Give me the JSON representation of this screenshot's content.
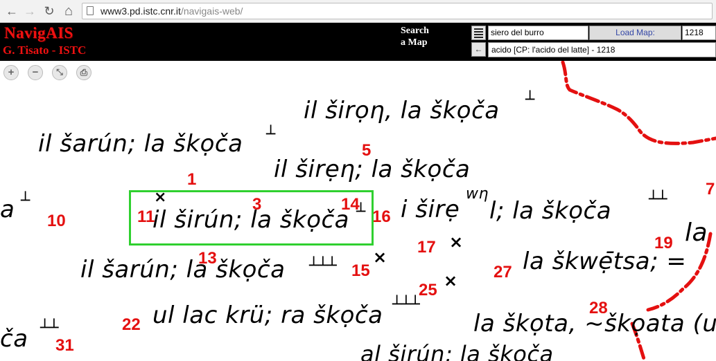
{
  "browser": {
    "back": "←",
    "forward": "→",
    "reload": "↻",
    "home": "⌂",
    "url_host": "www3.pd.istc.cnr.it",
    "url_path": "/navigais-web/"
  },
  "header": {
    "title": "NavigAIS",
    "subtitle": "G. Tisato - ISTC",
    "search_line1": "Search",
    "search_line2": "a Map",
    "query_value": "siero del burro",
    "load_label": "Load Map:",
    "map_number": "1218",
    "back_glyph": "←",
    "result_value": "acido [CP: l'acido del latte] - 1218"
  },
  "zoom": {
    "in": "+",
    "out": "−",
    "fit": "⤡",
    "print": "⎙"
  },
  "map": {
    "texts": [
      "il širọη, la škọča",
      "il šarún; la škọča",
      "il širẹη; la škọča",
      "a",
      "il širún; la škọča",
      "i širẹ",
      "wη",
      "l; la škọča",
      "la",
      "il šarún; la škọča",
      "la škwẹ̄tsa; =",
      "ul lac krü; ra škọča",
      "la škọta, ~škọata (u",
      "ča",
      "al širún; la škọča"
    ],
    "numbers": [
      "5",
      "1",
      "3",
      "14",
      "11",
      "10",
      "16",
      "17",
      "19",
      "13",
      "15",
      "27",
      "25",
      "28",
      "22",
      "31",
      "7"
    ],
    "marks": [
      "┴",
      "┴",
      "┴",
      "┴",
      "┴┴",
      "×",
      "×",
      "×",
      "×",
      "┴┴┴",
      "┴┴┴",
      "┴┴"
    ]
  }
}
